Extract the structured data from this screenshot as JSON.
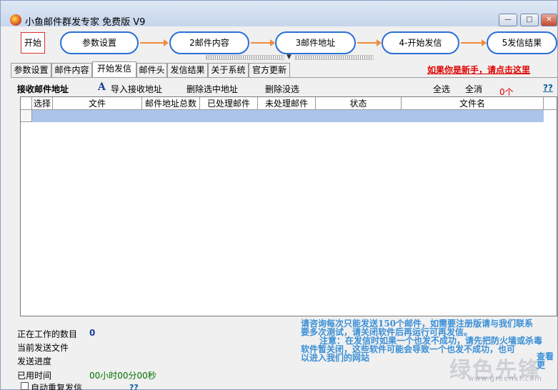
{
  "window": {
    "title": "小鱼邮件群发专家 免费版 V9",
    "minimize": "—",
    "maximize": "□",
    "close": "✕"
  },
  "steps": {
    "start": "开始",
    "items": [
      "参数设置",
      "2邮件内容",
      "3邮件地址",
      "4-开始发信",
      "5发信结果"
    ]
  },
  "tabs": [
    "参数设置",
    "邮件内容",
    "开始发信",
    "邮件头",
    "发信结果",
    "关于系统",
    "官方更新"
  ],
  "active_tab": "开始发信",
  "newbie_link": "如果你是新手，请点击这里",
  "toolbar": {
    "recv_label": "接收邮件地址",
    "import_label": "导入接收地址",
    "delete_selected": "删除选中地址",
    "delete_unselected": "删除没选",
    "select_all": "全选",
    "deselect_all": "全消",
    "count": "0个",
    "help": "??"
  },
  "grid": {
    "columns": [
      "选择",
      "文件",
      "邮件地址总数",
      "已处理邮件",
      "未处理邮件",
      "状态",
      "文件名"
    ]
  },
  "status": {
    "working_label": "正在工作的数目",
    "working_value": "0",
    "current_file_label": "当前发送文件",
    "progress_label": "发送进度",
    "elapsed_label": "已用时间",
    "elapsed_value": "00小时00分00秒",
    "auto_resend_label": "自动重复发信",
    "auto_resend_help": "??"
  },
  "notice": {
    "line1": "请咨询每次只能发送150个邮件，如需要注册版请与我们联系",
    "line2": "要多次测试，请关闭软件后再运行可再发信。",
    "line3": "注意：在发信时如果一个也发不成功，请先把防火墙或杀毒",
    "line4": "软件暂关闭，这些软件可能会导致一个也发不成功，也可",
    "line5": "以进入我们的网站",
    "line5_tail": "查看更"
  },
  "watermark": {
    "text": "绿色先锋",
    "url": "www.greenxf.com"
  }
}
